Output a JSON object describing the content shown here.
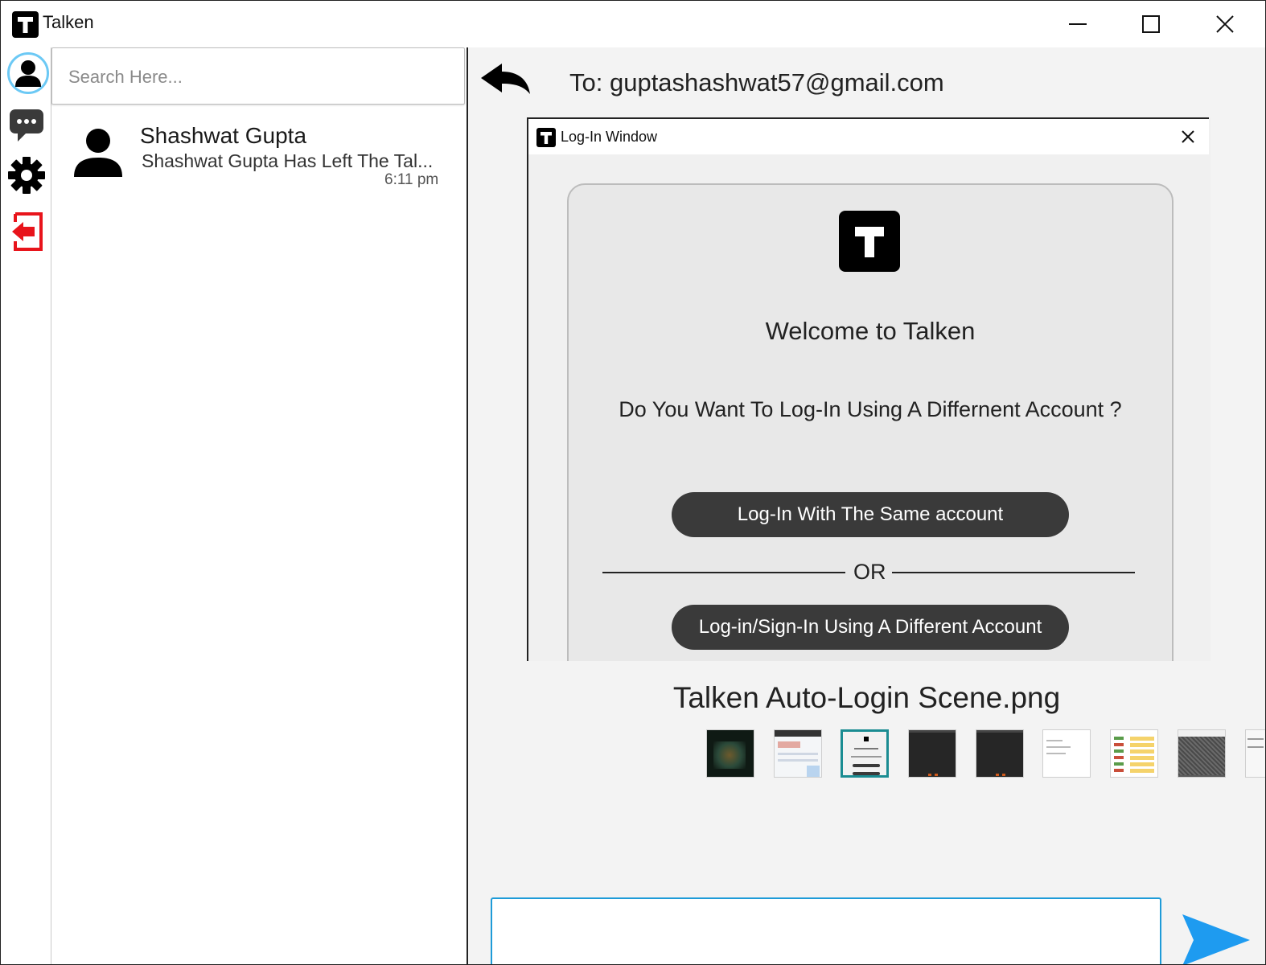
{
  "window": {
    "title": "Talken",
    "logo_letter": "T",
    "controls": [
      "minimize",
      "maximize",
      "close"
    ]
  },
  "rail": {
    "items": [
      {
        "name": "profile",
        "icon": "user-circle-icon",
        "selected": true
      },
      {
        "name": "chats",
        "icon": "chat-bubble-icon"
      },
      {
        "name": "settings",
        "icon": "gear-icon"
      },
      {
        "name": "logout",
        "icon": "logout-icon",
        "color": "#e8141b"
      }
    ]
  },
  "search": {
    "placeholder": "Search Here...",
    "value": ""
  },
  "contacts": [
    {
      "name": "Shashwat Gupta",
      "last_message": "Shashwat Gupta Has Left The Tal...",
      "time": "6:11 pm"
    }
  ],
  "chat": {
    "to_label": "To: guptashashwat57@gmail.com",
    "attachment": {
      "filename": "Talken Auto-Login Scene.png",
      "preview": {
        "window_title": "Log-In Window",
        "logo_letter": "T",
        "welcome": "Welcome to Talken",
        "question": "Do You Want To Log-In Using A Differnent Account ?",
        "button_same": "Log-In With The Same account",
        "or_text": "OR",
        "button_different": "Log-in/Sign-In Using A Different Account"
      },
      "thumbnails": [
        {
          "style": "dark-green"
        },
        {
          "style": "light-blue"
        },
        {
          "style": "login-window",
          "selected": true
        },
        {
          "style": "dark"
        },
        {
          "style": "dark"
        },
        {
          "style": "white-doc"
        },
        {
          "style": "yellow-list"
        },
        {
          "style": "dark-noise"
        },
        {
          "style": "white-partial"
        }
      ]
    },
    "message_input": {
      "value": ""
    },
    "send_icon": "send-arrow-icon"
  },
  "colors": {
    "accent": "#1e9bd8",
    "send": "#1e9bf0",
    "logout": "#e8141b",
    "button_dark": "#3a3a3a",
    "thumb_selected": "#1a8c92"
  }
}
